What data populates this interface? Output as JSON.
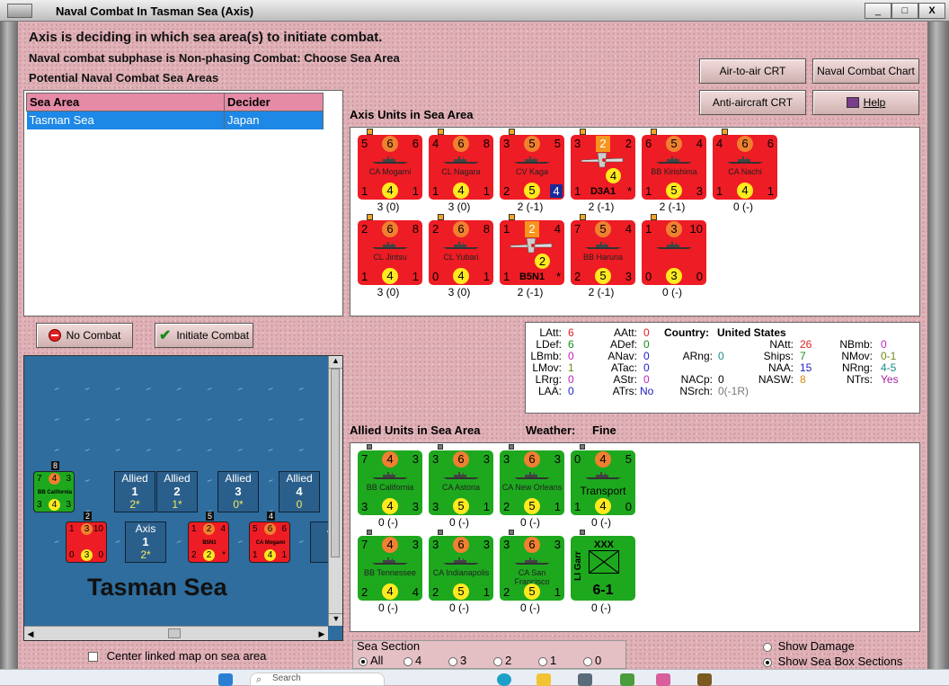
{
  "window": {
    "title": "Naval Combat In Tasman Sea (Axis)",
    "btn_min": "_",
    "btn_max": "□",
    "btn_close": "X"
  },
  "header": {
    "line1": "Axis is deciding in which sea area(s) to initiate combat.",
    "line2": "Naval combat subphase is Non-phasing Combat: Choose Sea Area",
    "line3": "Potential Naval Combat Sea Areas"
  },
  "buttons": {
    "air_to_air": "Air-to-air CRT",
    "naval_chart": "Naval Combat Chart",
    "anti_aircraft": "Anti-aircraft CRT",
    "help": "Help",
    "no_combat": "No Combat",
    "initiate": "Initiate Combat"
  },
  "sea_table": {
    "headers": [
      "Sea Area",
      "Decider"
    ],
    "rows": [
      [
        "Tasman Sea",
        "Japan"
      ]
    ]
  },
  "axis_title": "Axis Units in Sea Area",
  "axis_units": [
    {
      "tl": "5",
      "tc": "6",
      "tr": "6",
      "name": "CA Mogami",
      "bl": "1",
      "bc": "4",
      "br": "1",
      "stat": "3 (0)"
    },
    {
      "tl": "4",
      "tc": "6",
      "tr": "8",
      "name": "CL Nagara",
      "bl": "1",
      "bc": "4",
      "br": "1",
      "stat": "3 (0)"
    },
    {
      "tl": "3",
      "tc": "5",
      "tr": "5",
      "name": "CV Kaga",
      "bl": "2",
      "bc": "5",
      "br": "4",
      "stat": "2 (-1)"
    },
    {
      "tl": "3",
      "tc": "2",
      "tr": "2",
      "name": "D3A1",
      "bl": "1",
      "bc": "4",
      "br": "*",
      "stat": "2 (-1)"
    },
    {
      "tl": "6",
      "tc": "5",
      "tr": "4",
      "name": "BB Kirishima",
      "bl": "1",
      "bc": "5",
      "br": "3",
      "stat": "2 (-1)"
    },
    {
      "tl": "4",
      "tc": "6",
      "tr": "6",
      "name": "CA Nachi",
      "bl": "1",
      "bc": "4",
      "br": "1",
      "stat": "0 (-)"
    },
    {
      "tl": "2",
      "tc": "6",
      "tr": "8",
      "name": "CL Jintsu",
      "bl": "1",
      "bc": "4",
      "br": "1",
      "stat": "3 (0)"
    },
    {
      "tl": "2",
      "tc": "6",
      "tr": "8",
      "name": "CL Yubari",
      "bl": "0",
      "bc": "4",
      "br": "1",
      "stat": "3 (0)"
    },
    {
      "tl": "1",
      "tc": "2",
      "tr": "4",
      "name": "B5N1",
      "bl": "1",
      "bc": "2",
      "br": "*",
      "stat": "2 (-1)"
    },
    {
      "tl": "7",
      "tc": "5",
      "tr": "4",
      "name": "BB Haruna",
      "bl": "2",
      "bc": "5",
      "br": "3",
      "stat": "2 (-1)"
    },
    {
      "tl": "1",
      "tc": "3",
      "tr": "10",
      "name": "",
      "bl": "0",
      "bc": "3",
      "br": "0",
      "stat": "0 (-)"
    }
  ],
  "info": {
    "LAtt": "6",
    "LDef": "6",
    "LBmb": "0",
    "LMov": "1",
    "LRrg": "0",
    "LAA": "0",
    "AAtt": "0",
    "ADef": "0",
    "ANav": "0",
    "ATac": "0",
    "AStr": "0",
    "ATrs": "No",
    "ARng": "0",
    "NACp": "0",
    "NSrch": "0(-1R)",
    "country_label": "Country:",
    "country": "United States",
    "NAtt": "26",
    "Ships": "7",
    "NAA": "15",
    "NASW": "8",
    "NBmb": "0",
    "NMov": "0-1",
    "NRng": "4-5",
    "NTrs": "Yes"
  },
  "allied_title": "Allied Units in Sea Area",
  "weather_label": "Weather:",
  "weather": "Fine",
  "allied_units": [
    {
      "tl": "7",
      "tc": "4",
      "tr": "3",
      "name": "BB California",
      "bl": "3",
      "bc": "4",
      "br": "3",
      "stat": "0 (-)"
    },
    {
      "tl": "3",
      "tc": "6",
      "tr": "3",
      "name": "CA Astoria",
      "bl": "3",
      "bc": "5",
      "br": "1",
      "stat": "0 (-)"
    },
    {
      "tl": "3",
      "tc": "6",
      "tr": "3",
      "name": "CA New Orleans",
      "bl": "2",
      "bc": "5",
      "br": "1",
      "stat": "0 (-)"
    },
    {
      "tl": "0",
      "tc": "4",
      "tr": "5",
      "name": "Transport",
      "bl": "1",
      "bc": "4",
      "br": "0",
      "stat": "0 (-)"
    },
    {
      "tl": "7",
      "tc": "4",
      "tr": "3",
      "name": "BB Tennessee",
      "bl": "2",
      "bc": "4",
      "br": "4",
      "stat": "0 (-)"
    },
    {
      "tl": "3",
      "tc": "6",
      "tr": "3",
      "name": "CA Indianapolis",
      "bl": "2",
      "bc": "5",
      "br": "1",
      "stat": "0 (-)"
    },
    {
      "tl": "3",
      "tc": "6",
      "tr": "3",
      "name": "CA San Francisco",
      "bl": "2",
      "bc": "5",
      "br": "1",
      "stat": "0 (-)"
    },
    {
      "name": "LI Garr",
      "top": "XXX",
      "val": "6-1",
      "stat": "0 (-)"
    }
  ],
  "map": {
    "sea_name": "Tasman Sea",
    "allied_boxes": [
      {
        "label": "Allied",
        "num": "1",
        "val": "2*"
      },
      {
        "label": "Allied",
        "num": "2",
        "val": "1*"
      },
      {
        "label": "Allied",
        "num": "3",
        "val": "0*"
      },
      {
        "label": "Allied",
        "num": "4",
        "val": "0"
      }
    ],
    "axis_box": {
      "label": "Axis",
      "num": "1",
      "val": "2*"
    },
    "stack_counts": [
      "8",
      "2",
      "5",
      "4"
    ],
    "mini_units": [
      {
        "name": "BB California",
        "tl": "7",
        "tc": "4",
        "tr": "3",
        "bl": "3",
        "bc": "4",
        "br": "3"
      },
      {
        "name": "",
        "tl": "1",
        "tc": "3",
        "tr": "10",
        "bl": "0",
        "bc": "3",
        "br": "0"
      },
      {
        "name": "B5N1",
        "tl": "1",
        "tc": "2",
        "tr": "4",
        "bl": "2",
        "bc": "2",
        "br": "*"
      },
      {
        "name": "CA Mogami",
        "tl": "5",
        "tc": "6",
        "tr": "6",
        "bl": "1",
        "bc": "4",
        "br": "1"
      }
    ],
    "axis_partial": "A"
  },
  "center_map_label": "Center linked map on sea area",
  "sea_section": {
    "title": "Sea Section",
    "options": [
      "All",
      "4",
      "3",
      "2",
      "1",
      "0"
    ],
    "selected": "All"
  },
  "show_damage": "Show Damage",
  "show_sections": "Show Sea Box Sections",
  "taskbar": {
    "search": "Search"
  },
  "colors": {
    "axis_red": "#ee1c24",
    "allied_green": "#1ea81e",
    "selection_blue": "#1e88e6",
    "header_pink": "#e58ba6"
  }
}
